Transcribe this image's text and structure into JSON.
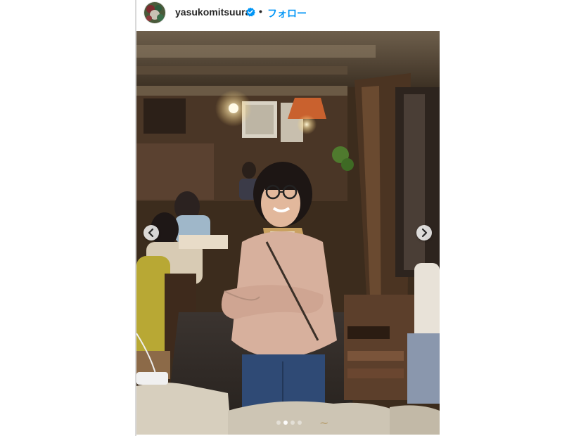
{
  "post": {
    "username": "yasukomitsuura",
    "separator": "•",
    "follow_label": "フォロー",
    "verified": true,
    "accent_color": "#0095f6",
    "verified_color": "#0095f6"
  },
  "icons": {
    "avatar": "profile-avatar",
    "verified": "verified-badge-icon",
    "prev": "chevron-left-icon",
    "next": "chevron-right-icon"
  },
  "carousel": {
    "slide_count": 4,
    "active_index": 1
  }
}
